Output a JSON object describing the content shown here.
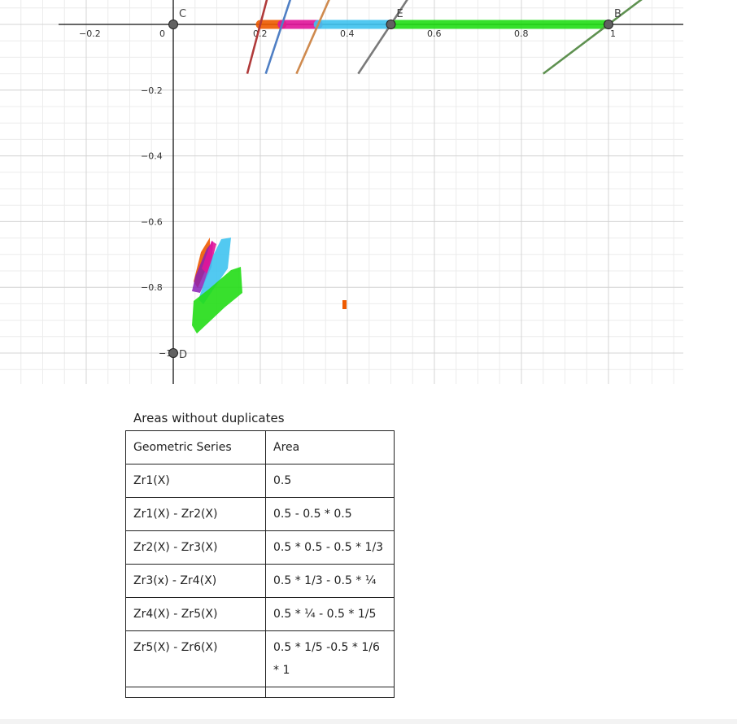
{
  "graph": {
    "x_ticks": [
      {
        "value": -0.2,
        "label": "−0.2"
      },
      {
        "value": 0,
        "label": "0"
      },
      {
        "value": 0.2,
        "label": "0.2"
      },
      {
        "value": 0.4,
        "label": "0.4"
      },
      {
        "value": 0.6,
        "label": "0.6"
      },
      {
        "value": 0.8,
        "label": "0.8"
      },
      {
        "value": 1,
        "label": "1"
      }
    ],
    "y_ticks": [
      {
        "value": -0.2,
        "label": "−0.2"
      },
      {
        "value": -0.4,
        "label": "−0.4"
      },
      {
        "value": -0.6,
        "label": "−0.6"
      },
      {
        "value": -0.8,
        "label": "−0.8"
      },
      {
        "value": -1,
        "label": "−1"
      }
    ],
    "points": [
      {
        "name": "C",
        "x": 0,
        "y": 0
      },
      {
        "name": "E",
        "x": 0.5,
        "y": 0
      },
      {
        "name": "B",
        "x": 1,
        "y": 0
      },
      {
        "name": "D",
        "x": 0,
        "y": -1
      }
    ],
    "lines": [
      {
        "id": "line-red",
        "color": "#b03a3a",
        "x_intercept": 0.2
      },
      {
        "id": "line-blue",
        "color": "#4f7fc4",
        "x_intercept": 0.25
      },
      {
        "id": "line-orange",
        "color": "#cf8a4e",
        "x_intercept": 0.333
      },
      {
        "id": "line-gray",
        "color": "#7a7a7a",
        "x_intercept": 0.5
      },
      {
        "id": "line-green",
        "color": "#5e9150",
        "x_intercept": 1
      }
    ],
    "highlights": [
      {
        "color": "#ee5a00",
        "x1": 0.2,
        "x2": 0.25
      },
      {
        "color": "#e0159a",
        "x1": 0.25,
        "x2": 0.333
      },
      {
        "color": "#3fc3ef",
        "x1": 0.333,
        "x2": 0.5
      },
      {
        "color": "#22dd16",
        "x1": 0.5,
        "x2": 1
      }
    ]
  },
  "table": {
    "caption": "Areas without duplicates",
    "headers": [
      "Geometric Series",
      "Area"
    ],
    "rows": [
      [
        "Zr1(X)",
        "0.5"
      ],
      [
        "Zr1(X) - Zr2(X)",
        "0.5 - 0.5 * 0.5"
      ],
      [
        "Zr2(X) - Zr3(X)",
        "0.5 * 0.5 - 0.5 * 1/3"
      ],
      [
        "Zr3(x) - Zr4(X)",
        "0.5 * 1/3 - 0.5 * ¼"
      ],
      [
        "Zr4(X) - Zr5(X)",
        "0.5 * ¼ - 0.5 * 1/5"
      ],
      [
        "Zr5(X) - Zr6(X)",
        "0.5 * 1/5 -0.5 * 1/6 * 1"
      ],
      [
        "",
        ""
      ]
    ]
  }
}
